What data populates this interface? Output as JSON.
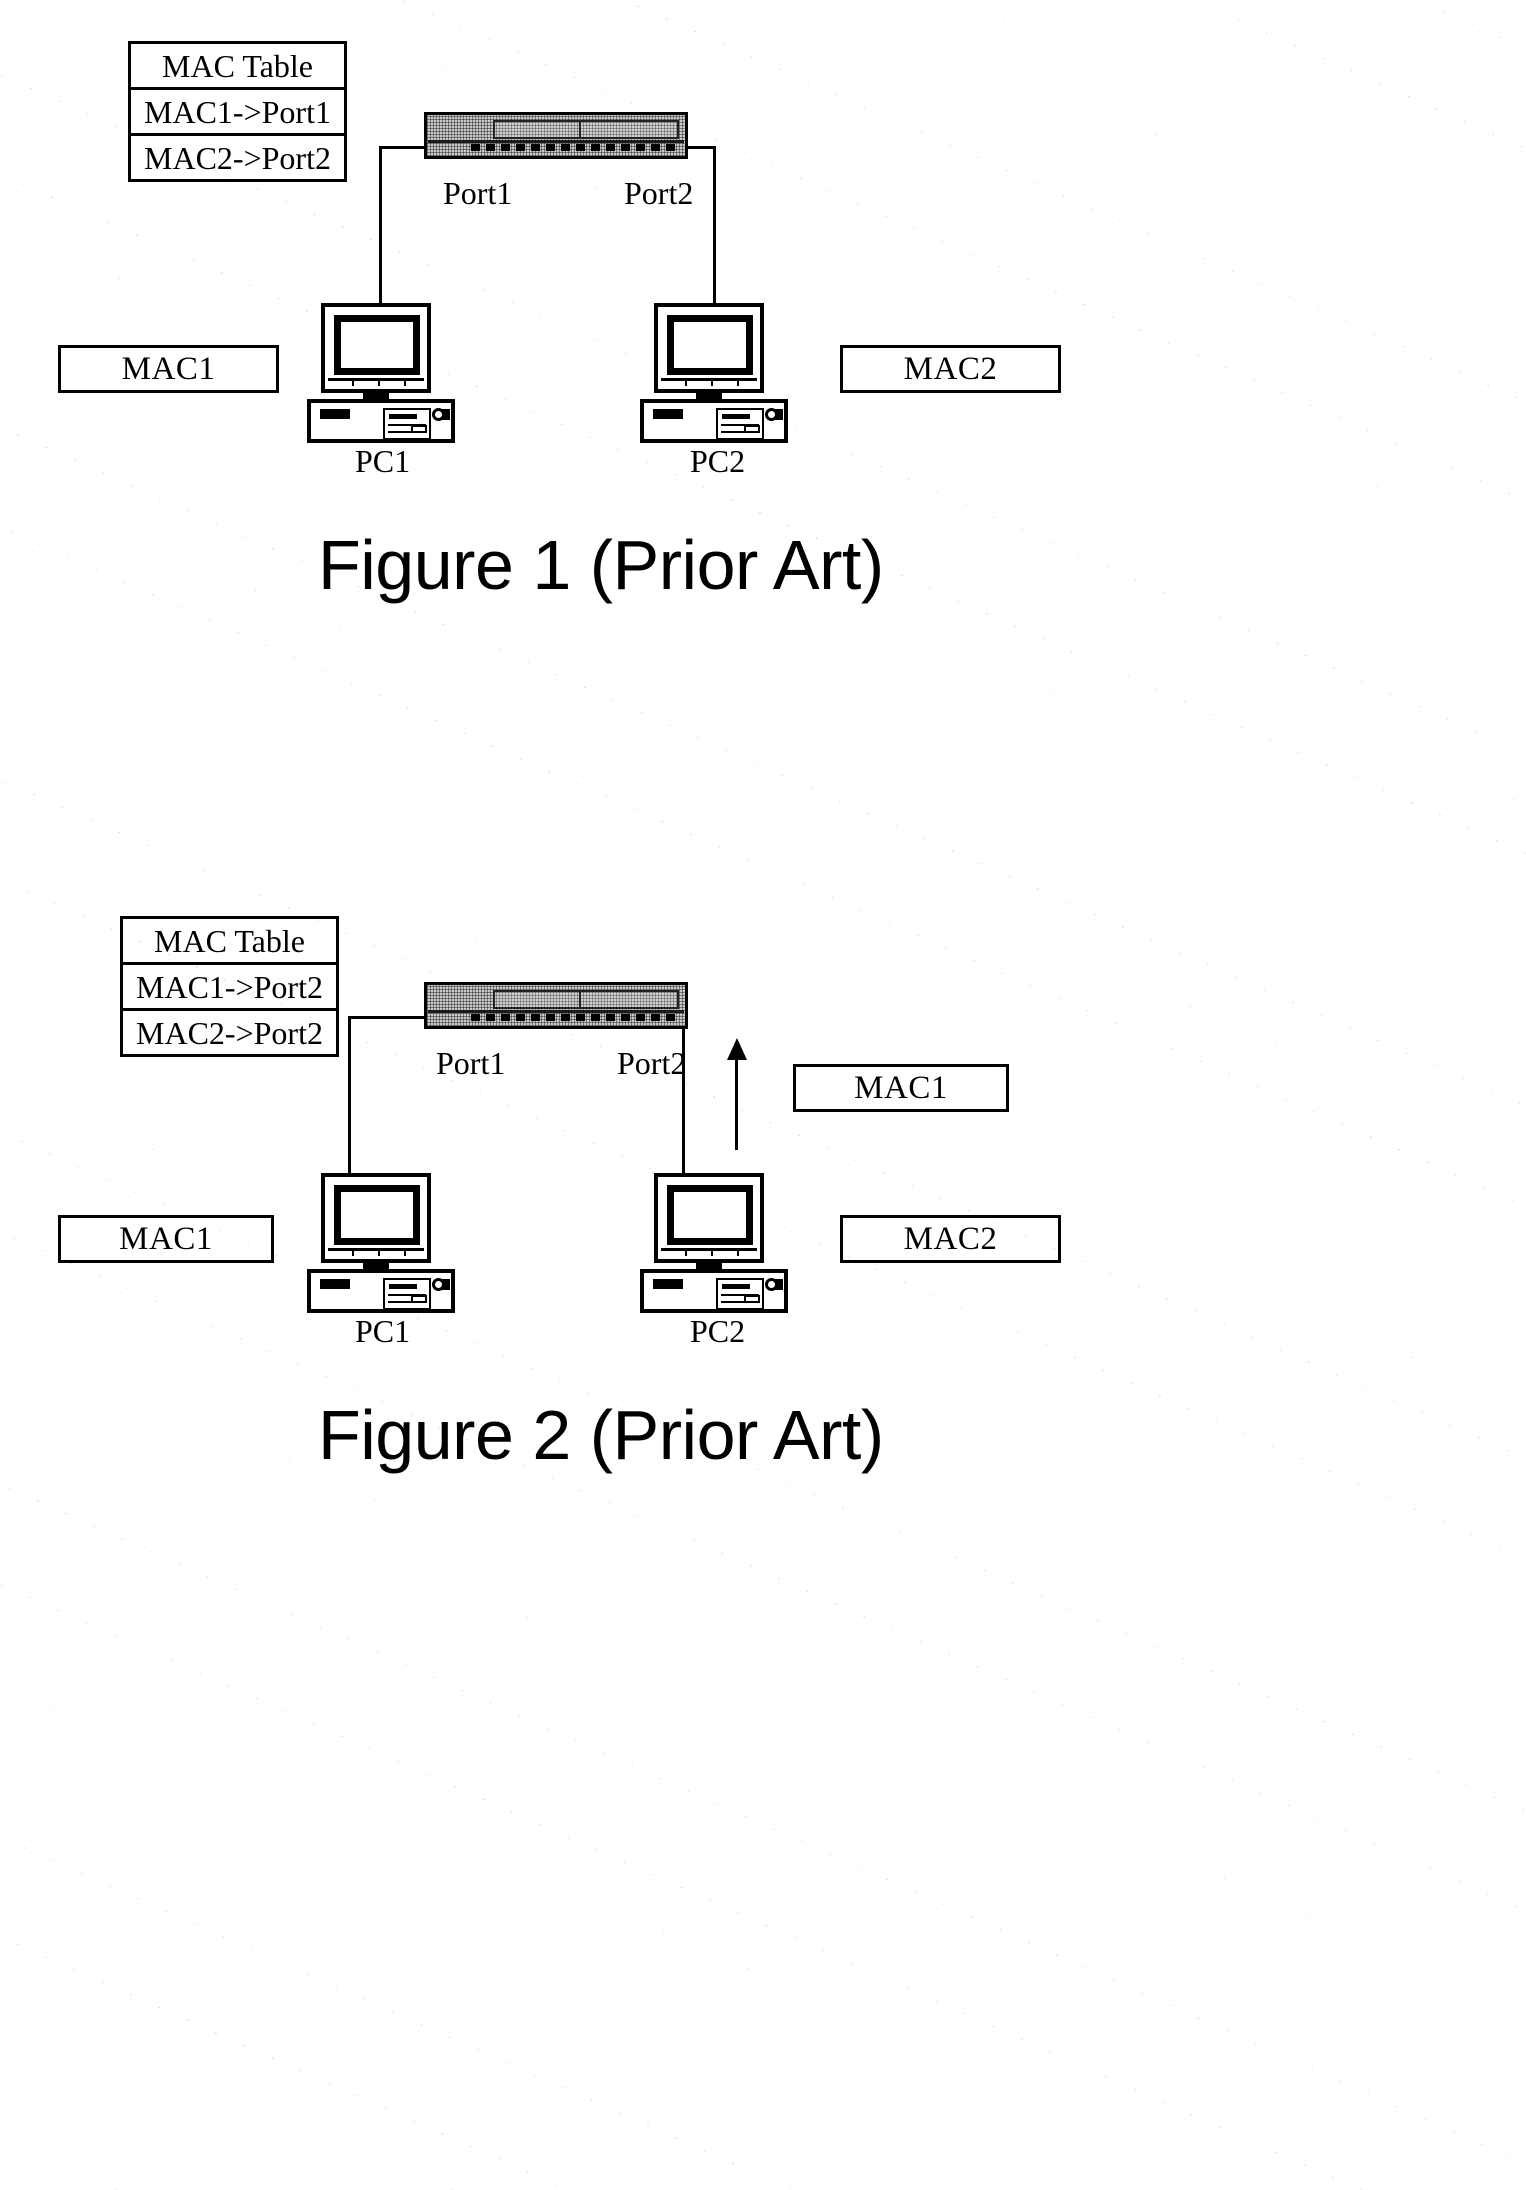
{
  "document": {
    "type": "patent-figure-sheet",
    "background_texture": "scanned-paper-speckle"
  },
  "figure1": {
    "caption": "Figure 1 (Prior Art)",
    "mac_table": {
      "header": "MAC Table",
      "rows": [
        "MAC1->Port1",
        "MAC2->Port2"
      ]
    },
    "switch": {
      "name": "ethernet-switch",
      "port_labels": [
        "Port1",
        "Port2"
      ]
    },
    "hosts": [
      {
        "label": "PC1",
        "mac_box": "MAC1"
      },
      {
        "label": "PC2",
        "mac_box": "MAC2"
      }
    ]
  },
  "figure2": {
    "caption": "Figure 2 (Prior Art)",
    "mac_table": {
      "header": "MAC Table",
      "rows": [
        "MAC1->Port2",
        "MAC2->Port2"
      ]
    },
    "switch": {
      "name": "ethernet-switch",
      "port_labels": [
        "Port1",
        "Port2"
      ]
    },
    "hosts": [
      {
        "label": "PC1",
        "mac_box": "MAC1"
      },
      {
        "label": "PC2",
        "mac_box": "MAC2"
      }
    ],
    "spoofed_frame": {
      "mac_box": "MAC1",
      "direction": "up"
    }
  },
  "colors": {
    "ink": "#000000",
    "paper": "#ffffff",
    "device_body": "#c9c9c9"
  }
}
